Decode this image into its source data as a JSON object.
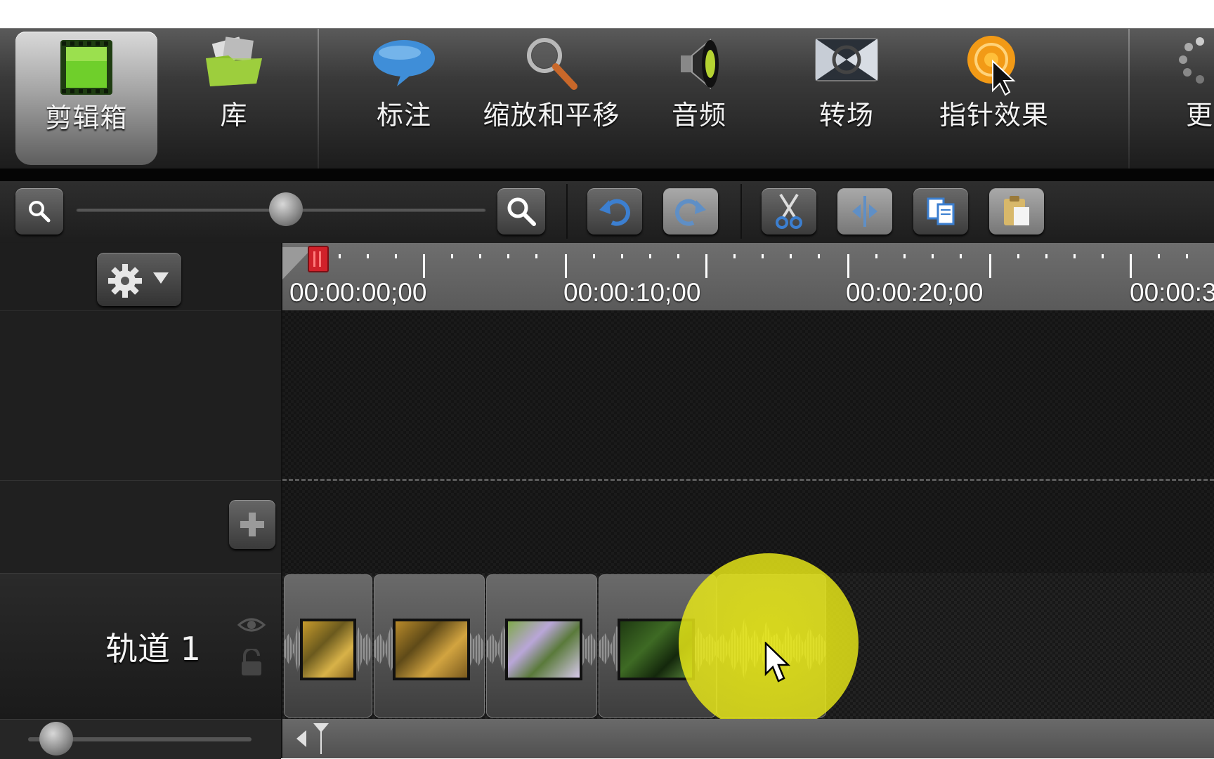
{
  "ribbon": {
    "tabs": [
      {
        "label": "剪辑箱",
        "icon": "film-strip-icon",
        "active": true
      },
      {
        "label": "库",
        "icon": "library-folder-icon"
      },
      {
        "label": "标注",
        "icon": "callout-bubble-icon"
      },
      {
        "label": "缩放和平移",
        "icon": "magnifier-icon"
      },
      {
        "label": "音频",
        "icon": "speaker-icon"
      },
      {
        "label": "转场",
        "icon": "transition-icon"
      },
      {
        "label": "指针效果",
        "icon": "cursor-effect-icon"
      }
    ],
    "more_label": "更"
  },
  "toolbar": {
    "buttons": [
      "zoom-out-icon",
      "zoom-in-icon",
      "undo-icon",
      "redo-icon",
      "cut-icon",
      "split-icon",
      "copy-icon",
      "paste-icon"
    ],
    "zoom_level": 0.5
  },
  "timeline": {
    "ruler": {
      "timecodes": [
        "00:00:00;00",
        "00:00:10;00",
        "00:00:20;00",
        "00:00:3"
      ]
    },
    "tracks": [
      {
        "label": "轨道 1"
      }
    ],
    "colors": {
      "highlight": "#e8e818",
      "playhead": "#d0212a"
    }
  }
}
